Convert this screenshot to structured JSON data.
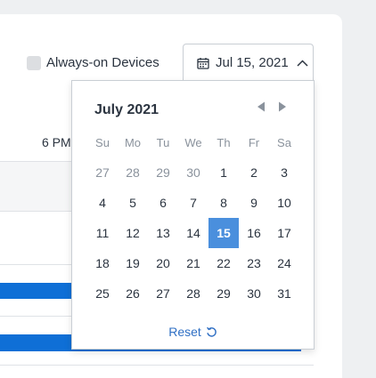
{
  "filters": {
    "always_on_label": "Always-on Devices",
    "always_on_checked": false
  },
  "date_picker": {
    "selected_label": "Jul 15, 2021"
  },
  "timeline": {
    "time_label": "6 PM"
  },
  "calendar": {
    "month_label": "July 2021",
    "weekdays": [
      "Su",
      "Mo",
      "Tu",
      "We",
      "Th",
      "Fr",
      "Sa"
    ],
    "days": [
      {
        "n": "27",
        "muted": true
      },
      {
        "n": "28",
        "muted": true
      },
      {
        "n": "29",
        "muted": true
      },
      {
        "n": "30",
        "muted": true
      },
      {
        "n": "1"
      },
      {
        "n": "2"
      },
      {
        "n": "3"
      },
      {
        "n": "4"
      },
      {
        "n": "5"
      },
      {
        "n": "6"
      },
      {
        "n": "7"
      },
      {
        "n": "8"
      },
      {
        "n": "9"
      },
      {
        "n": "10"
      },
      {
        "n": "11"
      },
      {
        "n": "12"
      },
      {
        "n": "13"
      },
      {
        "n": "14"
      },
      {
        "n": "15",
        "selected": true
      },
      {
        "n": "16"
      },
      {
        "n": "17"
      },
      {
        "n": "18"
      },
      {
        "n": "19"
      },
      {
        "n": "20"
      },
      {
        "n": "21"
      },
      {
        "n": "22"
      },
      {
        "n": "23"
      },
      {
        "n": "24"
      },
      {
        "n": "25"
      },
      {
        "n": "26"
      },
      {
        "n": "27"
      },
      {
        "n": "28"
      },
      {
        "n": "29"
      },
      {
        "n": "30"
      },
      {
        "n": "31"
      }
    ],
    "reset_label": "Reset"
  },
  "colors": {
    "accent": "#4a8fdd",
    "bar": "#0f6fd6",
    "link": "#2f6fc4"
  }
}
